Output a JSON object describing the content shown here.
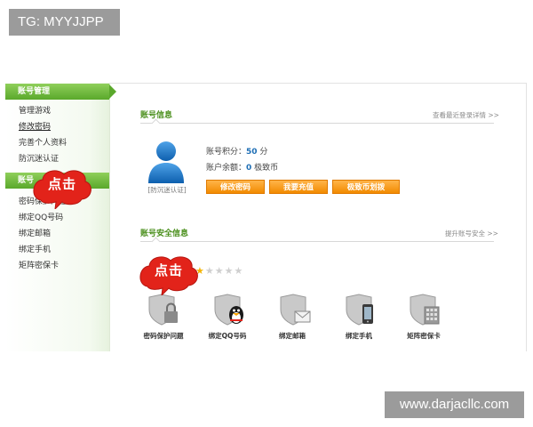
{
  "watermark_top": "TG: MYYJJPP",
  "watermark_bottom": "www.darjacllc.com",
  "sidebar": {
    "groups": [
      {
        "title": "账号管理",
        "items": [
          {
            "label": "管理游戏"
          },
          {
            "label": "修改密码",
            "active": true
          },
          {
            "label": "完善个人资料"
          },
          {
            "label": "防沉迷认证"
          }
        ]
      },
      {
        "title": "账号",
        "items": [
          {
            "label": "密码保护问题"
          },
          {
            "label": "绑定QQ号码"
          },
          {
            "label": "绑定邮箱"
          },
          {
            "label": "绑定手机"
          },
          {
            "label": "矩阵密保卡"
          }
        ]
      }
    ]
  },
  "account_info": {
    "title": "账号信息",
    "link": "查看最近登录详情 >>",
    "avatar_caption": "[防沉迷认证]",
    "points_label": "账号积分：",
    "points_value": "50",
    "points_unit": "分",
    "balance_label": "账户余额：",
    "balance_value": "0",
    "balance_unit": "极致币",
    "buttons": [
      {
        "label": "修改密码"
      },
      {
        "label": "我要充值"
      },
      {
        "label": "极致币划拨"
      }
    ]
  },
  "security_info": {
    "title": "账号安全信息",
    "link": "提升账号安全 >>",
    "stars_total": 5,
    "stars_filled": 1,
    "items": [
      {
        "label": "密码保护问题",
        "icon": "lock-shield-icon"
      },
      {
        "label": "绑定QQ号码",
        "icon": "qq-penguin-shield-icon"
      },
      {
        "label": "绑定邮箱",
        "icon": "mail-shield-icon"
      },
      {
        "label": "绑定手机",
        "icon": "phone-shield-icon"
      },
      {
        "label": "矩阵密保卡",
        "icon": "matrix-card-shield-icon"
      }
    ]
  },
  "callouts": [
    {
      "text": "点击"
    },
    {
      "text": "点击"
    }
  ],
  "colors": {
    "sidebar_header": "#5aa82b",
    "section_title": "#4a8f1c",
    "button_orange": "#f28a00",
    "callout_red": "#e2231a",
    "value_blue": "#1f6fb5"
  }
}
